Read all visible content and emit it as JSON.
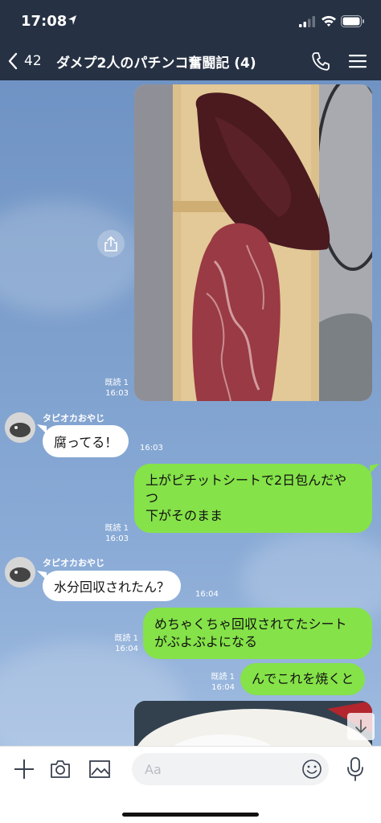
{
  "status_bar": {
    "time": "17:08"
  },
  "header": {
    "back_count": "42",
    "title": "ダメプ2人のパチンコ奮闘記 (4)"
  },
  "messages": [
    {
      "type": "image_out",
      "read": "既読 1",
      "time": "16:03"
    },
    {
      "type": "text_in",
      "sender": "タピオカおやじ",
      "text": "腐ってる！",
      "time": "16:03"
    },
    {
      "type": "text_out",
      "lines": [
        "上がピチットシートで2日包んだや",
        "つ",
        "下がそのまま"
      ],
      "read": "既読 1",
      "time": "16:03"
    },
    {
      "type": "text_in",
      "sender": "タピオカおやじ",
      "text": "水分回収されたん？",
      "time": "16:04"
    },
    {
      "type": "text_out",
      "lines": [
        "めちゃくちゃ回収されてたシート",
        "がぶよぶよになる"
      ],
      "read": "既読 1",
      "time": "16:04"
    },
    {
      "type": "text_out",
      "lines": [
        "んでこれを焼くと"
      ],
      "read": "既読 1",
      "time": "16:04"
    },
    {
      "type": "image_out"
    }
  ],
  "input": {
    "placeholder": "Aa"
  },
  "icons": [
    "location-arrow-icon",
    "signal-icon",
    "wifi-icon",
    "battery-icon",
    "chevron-left-icon",
    "phone-icon",
    "menu-icon",
    "share-icon",
    "arrow-down-icon",
    "plus-icon",
    "camera-icon",
    "image-icon",
    "emoji-icon",
    "microphone-icon"
  ],
  "colors": {
    "header_bg": "#263143",
    "outgoing_bubble": "#85e249",
    "incoming_bubble": "#ffffff",
    "chat_bg": "#7ea0cd"
  }
}
